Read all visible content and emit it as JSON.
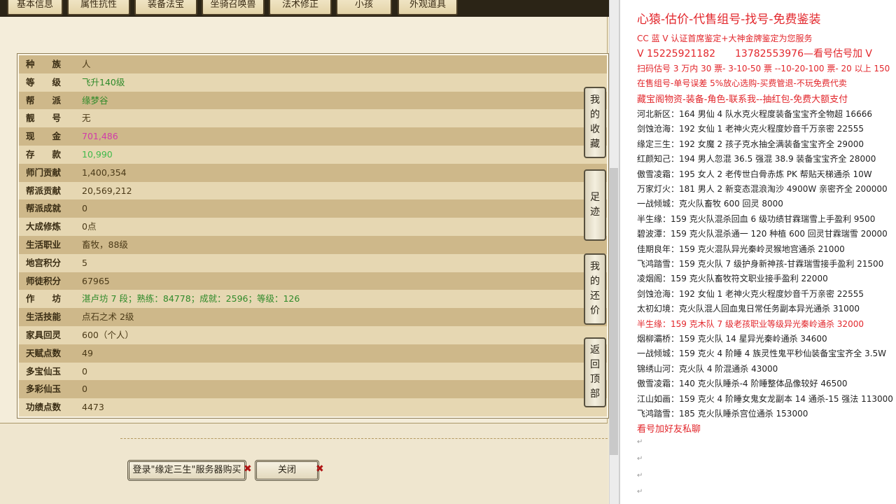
{
  "tabs": [
    "基本信息",
    "属性抗性",
    "装备法宝",
    "坐骑召唤兽",
    "法术修正",
    "小孩",
    "外观道具"
  ],
  "stats": [
    {
      "label": "种　　族",
      "value": "人",
      "tone": "normal"
    },
    {
      "label": "等　　级",
      "value": "飞升140级",
      "tone": "green"
    },
    {
      "label": "帮　　派",
      "value": "缘梦谷",
      "tone": "green"
    },
    {
      "label": "靓　　号",
      "value": "无",
      "tone": "normal"
    },
    {
      "label": "现　　金",
      "value": "701,486",
      "tone": "pink"
    },
    {
      "label": "存　　款",
      "value": "10,990",
      "tone": "lgreen"
    },
    {
      "label": "师门贡献",
      "value": "1,400,354",
      "tone": "normal"
    },
    {
      "label": "帮派贡献",
      "value": "20,569,212",
      "tone": "normal"
    },
    {
      "label": "帮派成就",
      "value": "0",
      "tone": "normal"
    },
    {
      "label": "大成修炼",
      "value": "0点",
      "tone": "normal"
    },
    {
      "label": "生活职业",
      "value": "畜牧，88级",
      "tone": "normal"
    },
    {
      "label": "地宫积分",
      "value": "5",
      "tone": "normal"
    },
    {
      "label": "师徒积分",
      "value": "67965",
      "tone": "normal"
    },
    {
      "label": "作　　坊",
      "value": "湛卢坊 7 段；熟练：84778；成就：2596；等级：126",
      "tone": "green"
    },
    {
      "label": "生活技能",
      "value": "点石之术 2级",
      "tone": "normal"
    },
    {
      "label": "家具回灵",
      "value": "600（个人）",
      "tone": "normal"
    },
    {
      "label": "天赋点数",
      "value": "49",
      "tone": "normal"
    },
    {
      "label": "多宝仙玉",
      "value": "0",
      "tone": "normal"
    },
    {
      "label": "多彩仙玉",
      "value": "0",
      "tone": "normal"
    },
    {
      "label": "功绩点数",
      "value": "4473",
      "tone": "normal"
    }
  ],
  "side_buttons": [
    {
      "name": "my-favorites",
      "chars": [
        "我",
        "的",
        "收",
        "藏"
      ]
    },
    {
      "name": "footprint",
      "chars": [
        "足",
        "迹"
      ]
    },
    {
      "name": "my-bargain",
      "chars": [
        "我",
        "的",
        "还",
        "价"
      ]
    },
    {
      "name": "back-to-top",
      "chars": [
        "返",
        "回",
        "顶",
        "部"
      ]
    }
  ],
  "bottom_buttons": {
    "login": "登录\"缘定三生\"服务器购买",
    "close": "关闭",
    "x": "✖"
  },
  "right_panel": {
    "title": "心猿-估价-代售组号-找号-免费鉴装",
    "lines_red": [
      "CC 蓝 V 认证首席鉴定+大神金牌鉴定为您服务",
      "扫码估号 3 万内 30 票- 3-10-50 票  --10-20-100 票- 20 以上 150",
      "在售组号-单号误差 5%放心选购-买费管退-不玩免费代卖",
      "藏宝阁物资-装备-角色-联系我--抽红包-免费大额支付"
    ],
    "contact": "V 15225921182　　13782553976—看号估号加 V",
    "listings": [
      "河北新区：164 男仙 4 队水克火程度装备宝宝齐全物超 16666",
      "剑蚀沧海：192 女仙 1 老神火克火程度妙音千万亲密 22555",
      "缘定三生：192 女魔 2 孩子克水抽全满装备宝宝齐全 29000",
      "红颜知己：194 男人忽混 36.5 强混 38.9 装备宝宝齐全 28000",
      "傲雪凌霜：195 女人 2 老传世白骨赤炼 PK 帮贴天梯通杀 10W",
      "万家灯火：181 男人 2 新变态混浪淘沙 4900W 亲密齐全 200000",
      "一战倾城：克火队畜牧 600 回灵 8000",
      "半生缘：159 克火队混杀回血 6 级功绩甘霖瑞雪上手盈利 9500",
      "碧波潭：159 克火队混杀通一 120 种植 600 回灵甘霖瑞雪 20000",
      "佳期良年：159 克火混队异光秦岭灵猴地宫通杀 21000",
      "飞鸿踏雪：159 克火队 7 级护身新神孩-甘霖瑞雪接手盈利 21500",
      "凌烟阁：159 克火队畜牧符文职业接手盈利 22000",
      "剑蚀沧海：192 女仙 1 老神火克火程度妙音千万亲密 22555",
      "太初幻境：克火队混人回血鬼日常任务副本异光通杀 31000",
      "半生缘：159 克木队 7 级老孩职业等级异光秦岭通杀 32000",
      "烟柳灞桥：159 克火队 14 星异光秦岭通杀 34600",
      "一战倾城：159 克火 4 阶睡 4 族灵性鬼平秒仙装备宝宝齐全 3.5W",
      "锦绣山河：克火队 4 阶混通杀 43000",
      "傲雪凌霜：140 克火队睡杀-4 阶睡整体品像较好 46500",
      "江山如画：159 克火 4 阶睡女鬼女龙副本 14 通杀-15 强法 113000",
      "飞鸿踏雪：185 克火队睡杀宫位通杀 153000"
    ],
    "red_listing_index": 14,
    "footer": "看号加好友私聊",
    "para_mark": "↵"
  }
}
